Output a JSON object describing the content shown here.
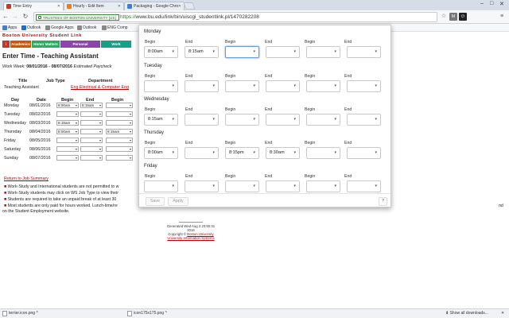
{
  "browser": {
    "tabs": [
      {
        "label": "Time Entry",
        "color": "#c0392b"
      },
      {
        "label": "Hourly - Edit Item",
        "color": "#e67e22"
      },
      {
        "label": "Packaging - Google Chro",
        "color": "#3b7ddd"
      }
    ],
    "secure_label": "TRUSTEES OF BOSTON UNIVERSITY [US]",
    "url_scheme": "https://",
    "url_rest": "www.bu.edu/link/bin/uiscgi_studentlink.pl/1470282208",
    "bookmarks": [
      "Apps",
      "Outlook",
      "Google Apps",
      "Outlook",
      "ENG Comp"
    ]
  },
  "page": {
    "site_title": "Boston University Student Link",
    "menu": [
      {
        "label": "i",
        "color": "#c0392b"
      },
      {
        "label": "Academics",
        "color": "#d35400"
      },
      {
        "label": "Honor Matters",
        "color": "#27ae60"
      },
      {
        "label": "Personal",
        "color": "#8e44ad"
      },
      {
        "label": "Work",
        "color": "#16a085"
      }
    ],
    "title": "Enter Time - Teaching Assistant",
    "work_week_label": "Work Week:",
    "work_week_value": "08/01/2016 - 08/07/2016",
    "est_paycheck": "Estimated Paycheck",
    "job_headers": {
      "title": "Title",
      "job_type": "Job Type",
      "department": "Department"
    },
    "job": {
      "title": "Teaching Assistant",
      "job_type": "Eng Electrical & Computer Eng"
    },
    "day_headers": {
      "day": "Day",
      "date": "Date",
      "begin": "Begin",
      "end": "End",
      "begin2": "Begin"
    },
    "days": [
      {
        "day": "Monday",
        "date": "08/01/2016",
        "begin": "8:00am",
        "end": "8:15am",
        "b2": ""
      },
      {
        "day": "Tuesday",
        "date": "08/02/2016",
        "begin": "",
        "end": "",
        "b2": ""
      },
      {
        "day": "Wednesday",
        "date": "08/03/2016",
        "begin": "8:15am",
        "end": "",
        "b2": ""
      },
      {
        "day": "Thursday",
        "date": "08/04/2016",
        "begin": "8:00am",
        "end": "",
        "b2": "8:15am"
      },
      {
        "day": "Friday",
        "date": "08/05/2016",
        "begin": "",
        "end": "",
        "b2": ""
      },
      {
        "day": "Saturday",
        "date": "08/06/2016",
        "begin": "",
        "end": "",
        "b2": ""
      },
      {
        "day": "Sunday",
        "date": "08/07/2016",
        "begin": "",
        "end": "",
        "b2": ""
      }
    ],
    "return_link": "Return to Job Summary",
    "bullets": [
      "Work-Study and International students are not permitted to w",
      "Work-Study students may click on WS Job Type to view their",
      "Students are required to take an unpaid break of at least 30",
      "Most students are only paid for hours worked. Lunch-time/re"
    ],
    "bullet_tail": "on the Student Employment website.",
    "bullet_cont_end": "nd",
    "footer": {
      "generated": "Generated Wed Aug 3 23:50:31 2016",
      "copyright": "Copyright ©",
      "org": "Boston University",
      "systems": "University Information Systems"
    }
  },
  "popup": {
    "headers": {
      "begin": "Begin",
      "end": "End"
    },
    "days": [
      {
        "name": "Monday",
        "values": [
          "8:00am",
          "8:15am",
          "",
          "",
          "",
          ""
        ]
      },
      {
        "name": "Tuesday",
        "values": [
          "",
          "",
          "",
          "",
          "",
          ""
        ]
      },
      {
        "name": "Wednesday",
        "values": [
          "8:15am",
          "",
          "",
          "",
          "",
          ""
        ]
      },
      {
        "name": "Thursday",
        "values": [
          "8:00am",
          "",
          "8:15pm",
          "8:30am",
          "",
          ""
        ]
      },
      {
        "name": "Friday",
        "values": [
          "",
          "",
          "",
          "",
          "",
          ""
        ]
      }
    ],
    "save": "Save",
    "apply": "Apply",
    "help": "?"
  },
  "downloads": {
    "items": [
      "terrier.icon.png",
      "icon175x175.png"
    ],
    "show_all": "Show all downloads..."
  }
}
